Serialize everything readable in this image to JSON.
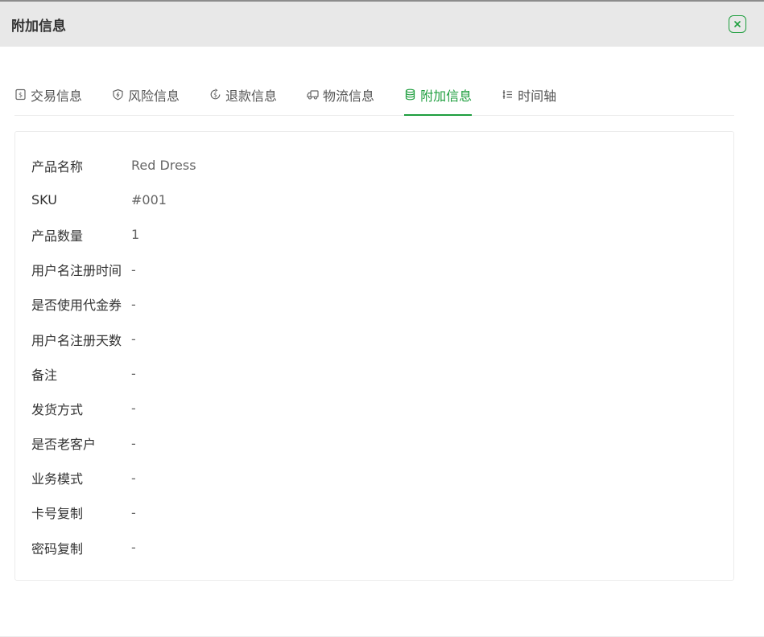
{
  "header": {
    "title": "附加信息"
  },
  "tabs": [
    {
      "label": "交易信息",
      "icon": "receipt-icon",
      "active": false
    },
    {
      "label": "风险信息",
      "icon": "shield-icon",
      "active": false
    },
    {
      "label": "退款信息",
      "icon": "refund-icon",
      "active": false
    },
    {
      "label": "物流信息",
      "icon": "truck-icon",
      "active": false
    },
    {
      "label": "附加信息",
      "icon": "database-icon",
      "active": true
    },
    {
      "label": "时间轴",
      "icon": "timeline-icon",
      "active": false
    }
  ],
  "details": [
    {
      "label": "产品名称",
      "value": "Red Dress"
    },
    {
      "label": "SKU",
      "value": "#001"
    },
    {
      "label": "产品数量",
      "value": "1"
    },
    {
      "label": "用户名注册时间",
      "value": "-"
    },
    {
      "label": "是否使用代金券",
      "value": "-"
    },
    {
      "label": "用户名注册天数",
      "value": "-"
    },
    {
      "label": "备注",
      "value": "-"
    },
    {
      "label": "发货方式",
      "value": "-"
    },
    {
      "label": "是否老客户",
      "value": "-"
    },
    {
      "label": "业务模式",
      "value": "-"
    },
    {
      "label": "卡号复制",
      "value": "-"
    },
    {
      "label": "密码复制",
      "value": "-"
    }
  ],
  "colors": {
    "accent": "#1e9e3e",
    "header_bg": "#e8e8e8",
    "border": "#ececec"
  }
}
